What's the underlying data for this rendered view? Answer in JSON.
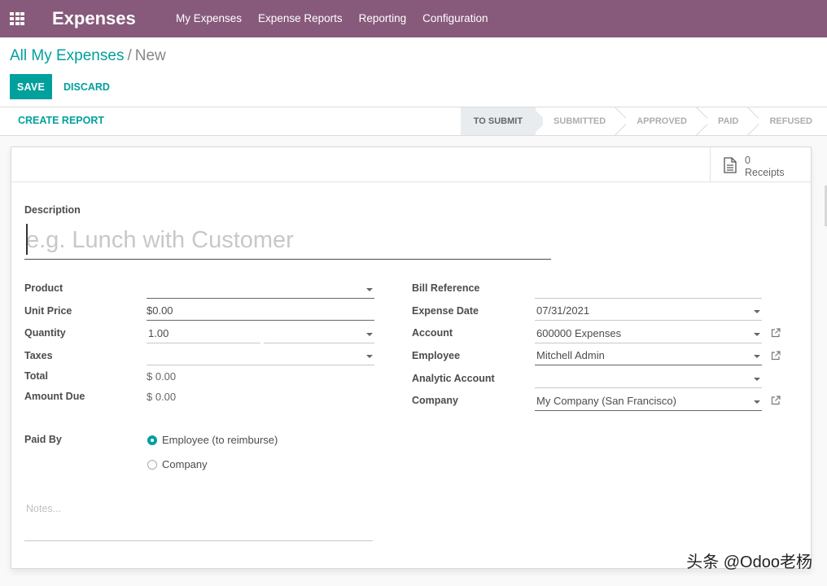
{
  "navbar": {
    "app_title": "Expenses",
    "menu": [
      {
        "label": "My Expenses"
      },
      {
        "label": "Expense Reports"
      },
      {
        "label": "Reporting"
      },
      {
        "label": "Configuration"
      }
    ],
    "bg_color": "#875a7b"
  },
  "breadcrumb": {
    "parent": "All My Expenses",
    "separator": "/",
    "current": "New"
  },
  "actions": {
    "save_label": "SAVE",
    "discard_label": "DISCARD"
  },
  "statusbar": {
    "create_report_label": "CREATE REPORT",
    "stages": [
      {
        "label": "TO SUBMIT",
        "active": true
      },
      {
        "label": "SUBMITTED",
        "active": false
      },
      {
        "label": "APPROVED",
        "active": false
      },
      {
        "label": "PAID",
        "active": false
      },
      {
        "label": "REFUSED",
        "active": false
      }
    ]
  },
  "receipts": {
    "count": "0",
    "label": "Receipts",
    "icon": "document-icon"
  },
  "form": {
    "description_label": "Description",
    "description_placeholder": "e.g. Lunch with Customer",
    "left": {
      "product_label": "Product",
      "product_value": "",
      "unit_price_label": "Unit Price",
      "unit_price_value": "$0.00",
      "quantity_label": "Quantity",
      "quantity_value": "1.00",
      "uom_value": "",
      "taxes_label": "Taxes",
      "taxes_value": "",
      "total_label": "Total",
      "total_value": "$ 0.00",
      "amount_due_label": "Amount Due",
      "amount_due_value": "$ 0.00"
    },
    "right": {
      "bill_reference_label": "Bill Reference",
      "bill_reference_value": "",
      "expense_date_label": "Expense Date",
      "expense_date_value": "07/31/2021",
      "account_label": "Account",
      "account_value": "600000 Expenses",
      "employee_label": "Employee",
      "employee_value": "Mitchell Admin",
      "analytic_account_label": "Analytic Account",
      "analytic_account_value": "",
      "company_label": "Company",
      "company_value": "My Company (San Francisco)"
    },
    "paid_by": {
      "label": "Paid By",
      "options": [
        {
          "label": "Employee (to reimburse)",
          "checked": true
        },
        {
          "label": "Company",
          "checked": false
        }
      ]
    },
    "notes_placeholder": "Notes..."
  },
  "watermark": "头条 @Odoo老杨",
  "colors": {
    "primary": "#00a09d",
    "brand": "#875a7b"
  }
}
